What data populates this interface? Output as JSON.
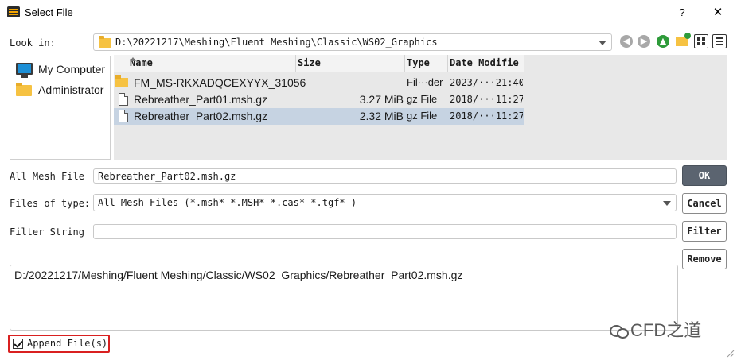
{
  "window": {
    "title": "Select File",
    "help_glyph": "?",
    "close_glyph": "✕"
  },
  "look_in": {
    "label": "Look in:",
    "path": "D:\\20221217\\Meshing\\Fluent Meshing\\Classic\\WS02_Graphics"
  },
  "toolbar": {
    "icons": [
      "back-arrow-icon",
      "forward-arrow-icon",
      "up-arrow-icon",
      "new-folder-icon",
      "list-view-icon",
      "detail-view-icon"
    ]
  },
  "sidebar": {
    "items": [
      {
        "label": "My Computer",
        "icon": "monitor-icon"
      },
      {
        "label": "Administrator",
        "icon": "folder-icon"
      }
    ]
  },
  "file_list": {
    "columns": [
      "Name",
      "Size",
      "Type",
      "Date Modifie"
    ],
    "rows": [
      {
        "name": "FM_MS-RKXADQCEXYYX_31056",
        "size": "",
        "type": "Fil···der",
        "date": "2023/···21:40",
        "kind": "folder",
        "selected": false
      },
      {
        "name": "Rebreather_Part01.msh.gz",
        "size": "3.27 MiB",
        "type": "gz File",
        "date": "2018/···11:27",
        "kind": "file",
        "selected": false
      },
      {
        "name": "Rebreather_Part02.msh.gz",
        "size": "2.32 MiB",
        "type": "gz File",
        "date": "2018/···11:27",
        "kind": "file",
        "selected": true
      }
    ]
  },
  "form": {
    "all_mesh_file_label": "All Mesh File",
    "all_mesh_file_value": "Rebreather_Part02.msh.gz",
    "files_of_type_label": "Files of type:",
    "files_of_type_value": "All Mesh Files (*.msh* *.MSH* *.cas* *.tgf* )",
    "filter_string_label": "Filter String",
    "filter_string_value": ""
  },
  "buttons": {
    "ok": "OK",
    "cancel": "Cancel",
    "filter": "Filter",
    "remove": "Remove"
  },
  "selected_paths": {
    "value": "D:/20221217/Meshing/Fluent Meshing/Classic/WS02_Graphics/Rebreather_Part02.msh.gz"
  },
  "append": {
    "label": "Append File(s)",
    "checked": true
  },
  "watermark": {
    "text": "CFD之道"
  },
  "colors": {
    "selection": "#c6d3e2",
    "ok_button": "#5b6470",
    "highlight_border": "#d92020",
    "folder": "#f6c242",
    "up_arrow": "#2e9b3a"
  }
}
